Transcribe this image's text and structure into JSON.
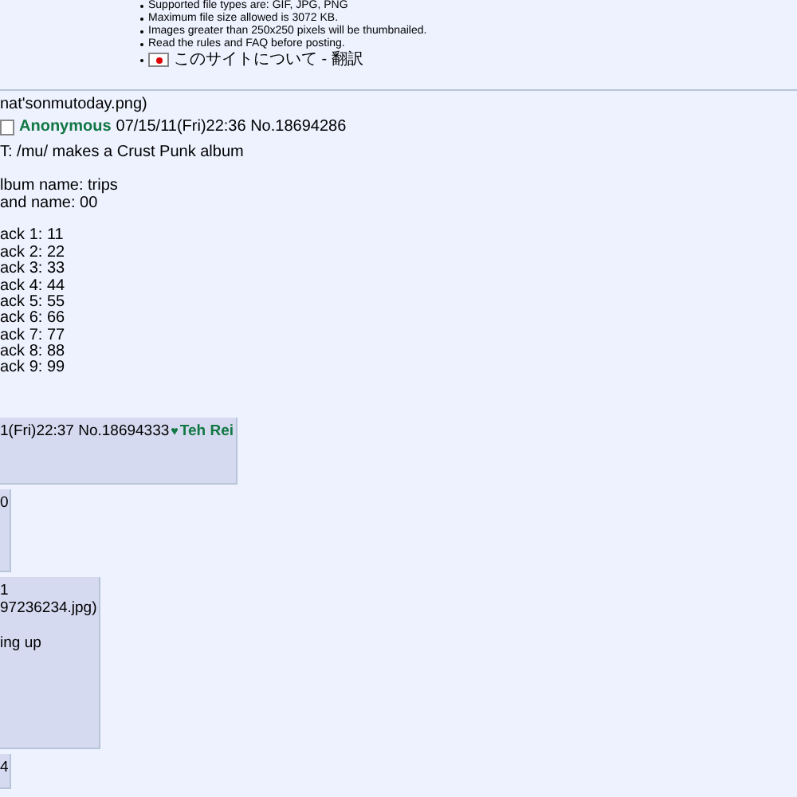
{
  "rules": [
    {
      "text": "Supported file types are: GIF, JPG, PNG"
    },
    {
      "text": "Maximum file size allowed is 3072 KB."
    },
    {
      "text": "Images greater than 250x250 pixels will be thumbnailed."
    },
    {
      "text": "Read the rules and FAQ before posting."
    },
    {
      "text": "このサイトについて - 翻訳",
      "kind": "flag"
    }
  ],
  "post": {
    "file": "nat'sonmutoday.png)",
    "checked": false,
    "name": "Anonymous",
    "date": "07/15/11(Fri)22:36 No.18694286",
    "paragraphs": [
      [
        "T: /mu/ makes a Crust Punk album"
      ],
      [
        "lbum name: trips",
        "and name: 00"
      ],
      [
        "ack 1: 11",
        "ack 2: 22",
        "ack 3: 33",
        "ack 4: 44",
        "ack 5: 55",
        "ack 6: 66",
        "ack 7: 77",
        "ack 8: 88",
        "ack 9: 99"
      ]
    ]
  },
  "replies": [
    {
      "lines": [
        "1(Fri)22:37 No.18694333"
      ],
      "heart": "♥",
      "name": "Teh Rei"
    },
    {
      "lines": [
        "0"
      ]
    },
    {
      "lines": [
        "1",
        "97236234.jpg)"
      ],
      "body": "ing up"
    },
    {
      "lines": [
        "4"
      ]
    }
  ]
}
